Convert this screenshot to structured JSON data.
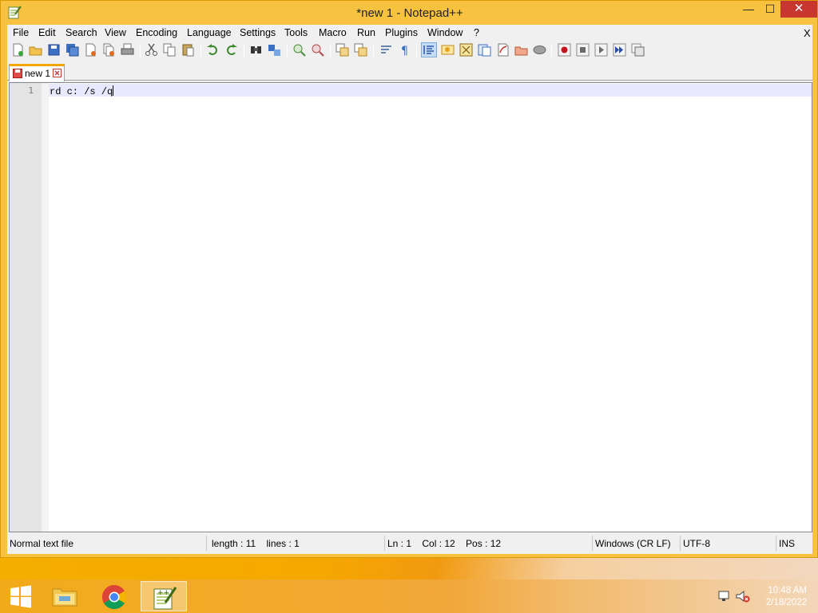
{
  "window": {
    "title": "*new 1 - Notepad++",
    "buttons": {
      "minimize": "—",
      "maximize": "☐",
      "close": "✕"
    }
  },
  "menubar": {
    "items": [
      "File",
      "Edit",
      "Search",
      "View",
      "Encoding",
      "Language",
      "Settings",
      "Tools",
      "Macro",
      "Run",
      "Plugins",
      "Window",
      "?"
    ],
    "close": "X"
  },
  "toolbar": {
    "buttons": [
      "new-file-icon",
      "open-file-icon",
      "save-icon",
      "save-all-icon",
      "close-icon",
      "close-all-icon",
      "print-icon",
      "cut-icon",
      "copy-icon",
      "paste-icon",
      "undo-icon",
      "redo-icon",
      "find-icon",
      "replace-icon",
      "zoom-in-icon",
      "zoom-out-icon",
      "sync-vertical-icon",
      "sync-horizontal-icon",
      "word-wrap-icon",
      "show-all-characters-icon",
      "indent-guide-icon",
      "user-language-icon",
      "doc-map-icon",
      "function-list-icon",
      "folder-as-workspace-icon",
      "open-folder-icon",
      "monitoring-icon",
      "record-macro-icon",
      "stop-recording-icon",
      "playback-macro-icon",
      "run-macro-multiple-icon",
      "save-macro-icon"
    ]
  },
  "tabs": [
    {
      "label": "new 1",
      "active": true,
      "modified": true
    }
  ],
  "editor": {
    "lines": [
      {
        "number": "1",
        "text": "rd c: /s /q"
      }
    ]
  },
  "statusbar": {
    "file_type": "Normal text file",
    "length_lines": "length : 11    lines : 1",
    "position": "Ln : 1    Col : 12    Pos : 12",
    "eol": "Windows (CR LF)",
    "encoding": "UTF-8",
    "mode": "INS"
  },
  "taskbar": {
    "apps": [
      "start-icon",
      "file-explorer-icon",
      "chrome-icon",
      "notepad-plus-plus-icon"
    ],
    "clock_time": "10:48 AM",
    "clock_date": "2/18/2022"
  },
  "colors": {
    "window_frame": "#f6c23f",
    "close_button": "#c7372f",
    "caret_line": "#e8e8ff",
    "tab_accent": "#f6a600"
  }
}
